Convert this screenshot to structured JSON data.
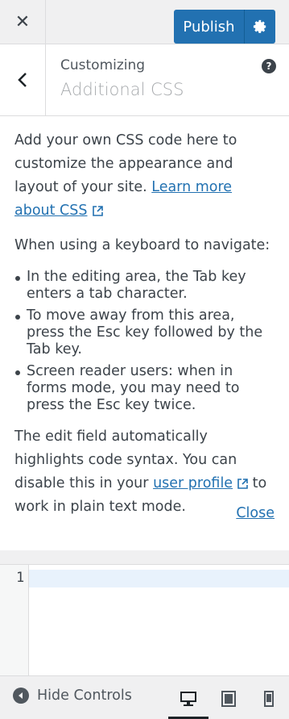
{
  "header": {
    "close_glyph": "✕",
    "publish_label": "Publish"
  },
  "section": {
    "breadcrumb": "Customizing",
    "title": "Additional CSS",
    "help_glyph": "?"
  },
  "description": {
    "intro_text": "Add your own CSS code here to customize the appearance and layout of your site.",
    "learn_link": "Learn more about CSS",
    "keyboard_heading": "When using a keyboard to navigate:",
    "bullets": [
      "In the editing area, the Tab key enters a tab character.",
      "To move away from this area, press the Esc key followed by the Tab key.",
      "Screen reader users: when in forms mode, you may need to press the Esc key twice."
    ],
    "syntax_pre": "The edit field automatically highlights code syntax. You can disable this in your",
    "profile_link": "user profile",
    "syntax_post": "to work in plain text mode.",
    "close_link": "Close"
  },
  "editor": {
    "line_number": "1"
  },
  "footer": {
    "hide_controls_label": "Hide Controls",
    "active_device": "desktop"
  },
  "colors": {
    "accent": "#2271b1",
    "active_line": "#e8f2fc"
  }
}
